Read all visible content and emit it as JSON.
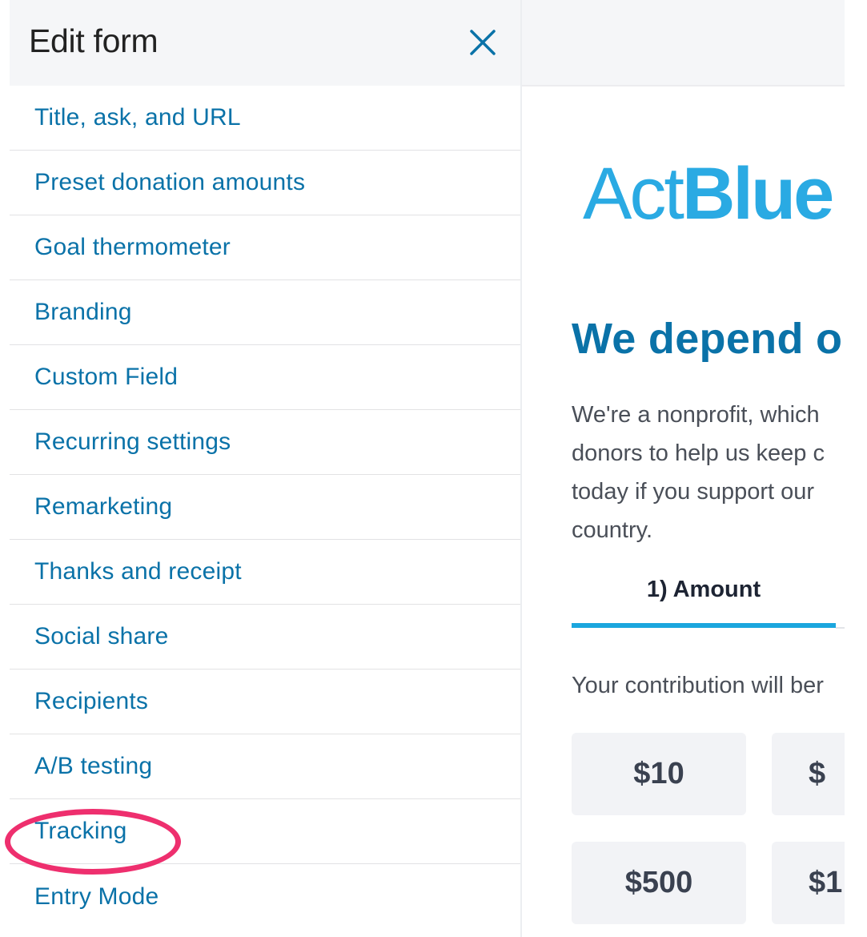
{
  "panel": {
    "title": "Edit form",
    "menu": [
      "Title, ask, and URL",
      "Preset donation amounts",
      "Goal thermometer",
      "Branding",
      "Custom Field",
      "Recurring settings",
      "Remarketing",
      "Thanks and receipt",
      "Social share",
      "Recipients",
      "A/B testing",
      "Tracking",
      "Entry Mode"
    ],
    "highlighted_item": "Tracking"
  },
  "preview": {
    "logo_light": "Act",
    "logo_bold": "Blue",
    "headline": "We depend o",
    "intro_lines": [
      "We're a nonprofit, which",
      "donors to help us keep c",
      "today if you support our",
      "country."
    ],
    "step_tab": "1) Amount",
    "contribution_text": "Your contribution will ber",
    "amounts": [
      "$10",
      "$",
      "$500",
      "$1"
    ]
  },
  "colors": {
    "link": "#0a72a8",
    "brand": "#2aaae3",
    "highlight": "#ee2f6e",
    "header_bg": "#f5f6f8"
  }
}
